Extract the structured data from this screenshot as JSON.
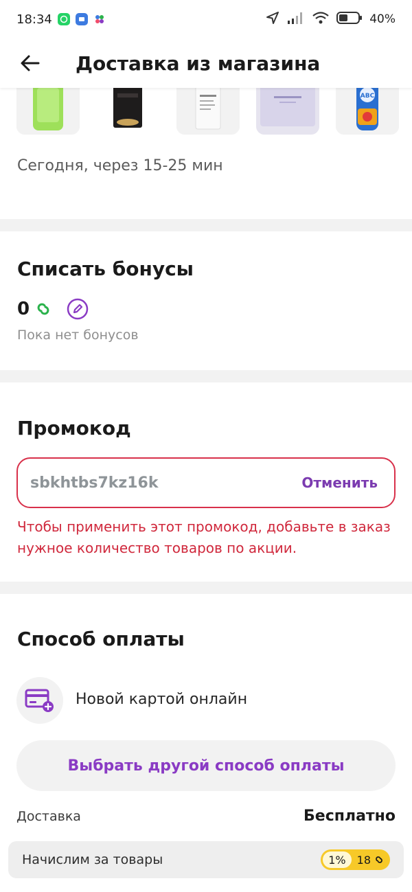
{
  "status_bar": {
    "time": "18:34",
    "battery": "40%",
    "icons": [
      "whatsapp-icon",
      "messages-icon",
      "dots-app-icon",
      "location-arrow-icon",
      "signal-icon",
      "wifi-icon",
      "battery-icon"
    ]
  },
  "header": {
    "title": "Доставка из магазина",
    "back_icon": "arrow-left-icon"
  },
  "products": [
    "green-bottle",
    "black-package",
    "white-box",
    "lavender-box",
    "abc-detergent"
  ],
  "delivery_time": "Сегодня, через 15-25 мин",
  "bonuses": {
    "title": "Списать бонусы",
    "value": "0",
    "empty_text": "Пока нет бонусов",
    "colors": {
      "bonus_icon": "#2bb24c",
      "edit_icon": "#8a3bc4"
    }
  },
  "promo": {
    "title": "Промокод",
    "code": "sbkhtbs7kz16k",
    "cancel_label": "Отменить",
    "error": "Чтобы применить этот промокод, добавьте в заказ нужное количество товаров по акции.",
    "colors": {
      "error": "#d0283c",
      "border": "#d8304a"
    }
  },
  "payment": {
    "title": "Способ оплаты",
    "method_label": "Новой картой онлайн",
    "other_button": "Выбрать другой способ оплаты",
    "colors": {
      "accent": "#8a3bc4"
    }
  },
  "summary": {
    "delivery_label": "Доставка",
    "delivery_value": "Бесплатно",
    "accrual_label": "Начислим за товары",
    "accrual_percent": "1%",
    "accrual_points": "18",
    "colors": {
      "badge": "#f7c928"
    }
  }
}
